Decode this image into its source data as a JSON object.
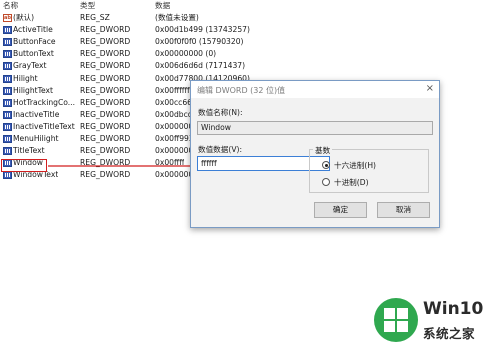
{
  "columns": {
    "name": "名称",
    "type": "类型",
    "data": "数据"
  },
  "rows": [
    {
      "name": "(默认)",
      "type": "REG_SZ",
      "data": "(数值未设置)",
      "icon": "string-value-icon"
    },
    {
      "name": "ActiveTitle",
      "type": "REG_DWORD",
      "data": "0x00d1b499 (13743257)",
      "icon": "binary-value-icon"
    },
    {
      "name": "ButtonFace",
      "type": "REG_DWORD",
      "data": "0x00f0f0f0 (15790320)",
      "icon": "binary-value-icon"
    },
    {
      "name": "ButtonText",
      "type": "REG_DWORD",
      "data": "0x00000000 (0)",
      "icon": "binary-value-icon"
    },
    {
      "name": "GrayText",
      "type": "REG_DWORD",
      "data": "0x006d6d6d (7171437)",
      "icon": "binary-value-icon"
    },
    {
      "name": "Hilight",
      "type": "REG_DWORD",
      "data": "0x00d77800 (14120960)",
      "icon": "binary-value-icon"
    },
    {
      "name": "HilightText",
      "type": "REG_DWORD",
      "data": "0x00ffffff",
      "icon": "binary-value-icon"
    },
    {
      "name": "HotTrackingCo...",
      "type": "REG_DWORD",
      "data": "0x00cc66",
      "icon": "binary-value-icon"
    },
    {
      "name": "InactiveTitle",
      "type": "REG_DWORD",
      "data": "0x00dbcd",
      "icon": "binary-value-icon"
    },
    {
      "name": "InactiveTitleText",
      "type": "REG_DWORD",
      "data": "0x000000",
      "icon": "binary-value-icon"
    },
    {
      "name": "MenuHilight",
      "type": "REG_DWORD",
      "data": "0x00ff993",
      "icon": "binary-value-icon"
    },
    {
      "name": "TitleText",
      "type": "REG_DWORD",
      "data": "0x000000",
      "icon": "binary-value-icon"
    },
    {
      "name": "Window",
      "type": "REG_DWORD",
      "data": "0x00ffff",
      "icon": "binary-value-icon"
    },
    {
      "name": "WindowText",
      "type": "REG_DWORD",
      "data": "0x000000",
      "icon": "binary-value-icon"
    }
  ],
  "dialog": {
    "title": "编辑 DWORD (32 位)值",
    "name_label": "数值名称(N):",
    "name_value": "Window",
    "data_label": "数值数据(V):",
    "data_value": "ffffff",
    "base_legend": "基数",
    "radio_hex": "十六进制(H)",
    "radio_dec": "十进制(D)",
    "hex_selected": true,
    "ok": "确定",
    "cancel": "取消",
    "close_glyph": "×"
  },
  "annotation": {
    "highlight_color": "#d21f1f"
  },
  "watermark": {
    "line1": "Win10",
    "line2": "系统之家",
    "circle_color": "#2fa84f"
  }
}
